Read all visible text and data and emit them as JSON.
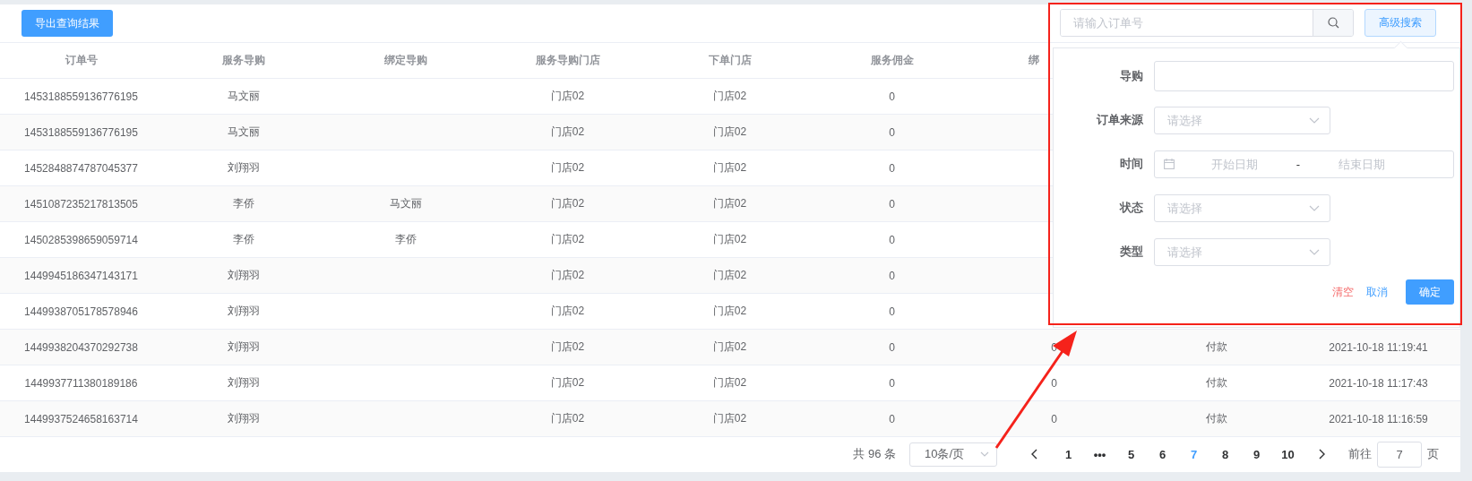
{
  "toolbar": {
    "export_button": "导出查询结果",
    "search": {
      "placeholder": "请输入订单号"
    },
    "advanced_button": "高级搜索"
  },
  "table": {
    "columns": [
      "订单号",
      "服务导购",
      "绑定导购",
      "服务导购门店",
      "下单门店",
      "服务佣金",
      "绑"
    ],
    "rows": [
      {
        "order_no": "1453188559136776195",
        "service_guide": "马文丽",
        "service_store": "门店02",
        "order_store": "门店02",
        "commission": "0"
      },
      {
        "order_no": "1453188559136776195",
        "service_guide": "马文丽",
        "service_store": "门店02",
        "order_store": "门店02",
        "commission": "0"
      },
      {
        "order_no": "1452848874787045377",
        "service_guide": "刘翔羽",
        "service_store": "门店02",
        "order_store": "门店02",
        "commission": "0"
      },
      {
        "order_no": "1451087235217813505",
        "service_guide": "李侨",
        "bound_guide": "马文丽",
        "service_store": "门店02",
        "order_store": "门店02",
        "commission": "0"
      },
      {
        "order_no": "1450285398659059714",
        "service_guide": "李侨",
        "bound_guide": "李侨",
        "service_store": "门店02",
        "order_store": "门店02",
        "commission": "0"
      },
      {
        "order_no": "1449945186347143171",
        "service_guide": "刘翔羽",
        "service_store": "门店02",
        "order_store": "门店02",
        "commission": "0"
      },
      {
        "order_no": "1449938705178578946",
        "service_guide": "刘翔羽",
        "service_store": "门店02",
        "order_store": "门店02",
        "commission": "0"
      },
      {
        "order_no": "1449938204370292738",
        "service_guide": "刘翔羽",
        "service_store": "门店02",
        "order_store": "门店02",
        "commission": "0",
        "column_7": "0",
        "column_8": "付款",
        "column_9": "2021-10-18 11:19:41"
      },
      {
        "order_no": "1449937711380189186",
        "service_guide": "刘翔羽",
        "service_store": "门店02",
        "order_store": "门店02",
        "commission": "0",
        "column_7": "0",
        "column_8": "付款",
        "column_9": "2021-10-18 11:17:43"
      },
      {
        "order_no": "1449937524658163714",
        "service_guide": "刘翔羽",
        "service_store": "门店02",
        "order_store": "门店02",
        "commission": "0",
        "column_7": "0",
        "column_8": "付款",
        "column_9": "2021-10-18 11:16:59"
      }
    ]
  },
  "advanced_search": {
    "fields": [
      {
        "kind": "text",
        "label": "导购"
      },
      {
        "kind": "select",
        "label": "订单来源",
        "placeholder": "请选择"
      },
      {
        "kind": "daterange",
        "label": "时间",
        "start_placeholder": "开始日期",
        "separator": "-",
        "end_placeholder": "结束日期"
      },
      {
        "kind": "select",
        "label": "状态",
        "placeholder": "请选择"
      },
      {
        "kind": "select",
        "label": "类型",
        "placeholder": "请选择"
      }
    ],
    "clear": "清空",
    "cancel": "取消",
    "confirm": "确定"
  },
  "pagination": {
    "total": "共 96 条",
    "page_size": "10条/页",
    "pages": [
      {
        "label": "1",
        "selected": false
      },
      {
        "label": "•••",
        "selected": false
      },
      {
        "label": "5",
        "selected": false
      },
      {
        "label": "6",
        "selected": false
      },
      {
        "label": "7",
        "selected": true
      },
      {
        "label": "8",
        "selected": false
      },
      {
        "label": "9",
        "selected": false
      },
      {
        "label": "10",
        "selected": false
      }
    ],
    "goto_label": "前往",
    "goto_value": "7",
    "goto_suffix": "页"
  },
  "annotations": {
    "highlight_frame": true,
    "arrow": true
  }
}
